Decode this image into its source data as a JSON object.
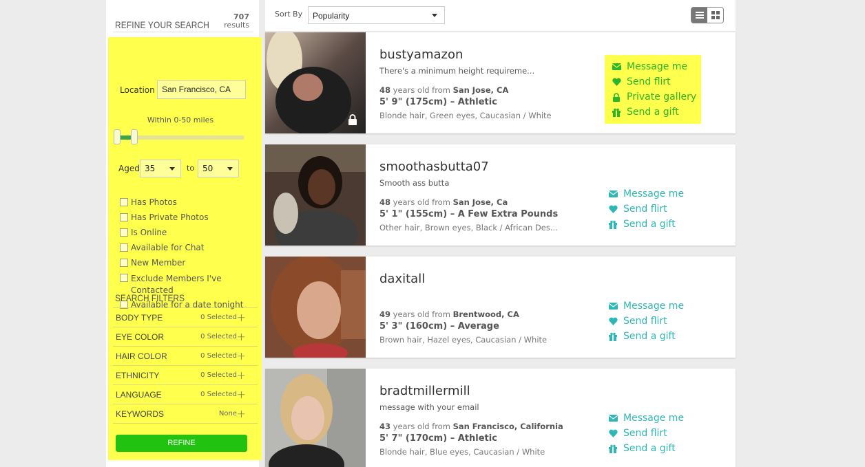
{
  "sidebar": {
    "title": "REFINE YOUR SEARCH",
    "results_count": "707",
    "results_label": "results",
    "location_label": "Location",
    "location_value": "San Francisco, CA",
    "within_text": "Within 0-50 miles",
    "aged_label": "Aged",
    "age_min": "35",
    "to_label": "to",
    "age_max": "50",
    "checkboxes": [
      "Has Photos",
      "Has Private Photos",
      "Is Online",
      "Available for Chat",
      "New Member",
      "Exclude Members I've Contacted",
      "Available for a date tonight"
    ],
    "filters_title": "SEARCH FILTERS",
    "filters": [
      {
        "name": "BODY TYPE",
        "value": "0 Selected"
      },
      {
        "name": "EYE COLOR",
        "value": "0 Selected"
      },
      {
        "name": "HAIR COLOR",
        "value": "0 Selected"
      },
      {
        "name": "ETHNICITY",
        "value": "0 Selected"
      },
      {
        "name": "LANGUAGE",
        "value": "0 Selected"
      },
      {
        "name": "KEYWORDS",
        "value": "None"
      }
    ],
    "refine_label": "REFINE"
  },
  "topbar": {
    "sort_label": "Sort By",
    "sort_value": "Popularity"
  },
  "profiles": [
    {
      "username": "bustyamazon",
      "tagline": "There's a minimum height requireme...",
      "age": "48",
      "age_suffix": " years old from ",
      "location": "San Jose, CA",
      "height": "5' 9\" (175cm) – Athletic",
      "details": "Blonde hair, Green eyes, Caucasian / White",
      "actions": [
        "Message me",
        "Send flirt",
        "Private gallery",
        "Send a gift"
      ]
    },
    {
      "username": "smoothasbutta07",
      "tagline": "Smooth ass butta",
      "age": "48",
      "age_suffix": " years old from ",
      "location": "San Jose, Ca",
      "height": "5' 1\" (155cm) – A Few Extra Pounds",
      "details": "Other hair, Brown eyes, Black / African Des...",
      "actions": [
        "Message me",
        "Send flirt",
        "Send a gift"
      ]
    },
    {
      "username": "daxitall",
      "tagline": "",
      "age": "49",
      "age_suffix": " years old from ",
      "location": "Brentwood, CA",
      "height": "5' 3\" (160cm) – Average",
      "details": "Brown hair, Hazel eyes, Caucasian / White",
      "actions": [
        "Message me",
        "Send flirt",
        "Send a gift"
      ]
    },
    {
      "username": "bradtmillermill",
      "tagline": "message with your email",
      "age": "43",
      "age_suffix": " years old from ",
      "location": "San Francisco, California",
      "height": "5' 7\" (170cm) – Athletic",
      "details": "Blonde hair, Blue eyes, Caucasian / White",
      "actions": [
        "Message me",
        "Send flirt",
        "Send a gift"
      ]
    }
  ],
  "colors": {
    "highlight": "#ffff4d",
    "refine_button": "#22c211",
    "action_green": "#2ab52a",
    "action_teal": "#2fb7b5"
  },
  "icons": [
    "envelope-icon",
    "heart-icon",
    "lock-icon",
    "gift-icon",
    "list-view-icon",
    "grid-view-icon",
    "plus-icon",
    "chevron-down-icon"
  ]
}
